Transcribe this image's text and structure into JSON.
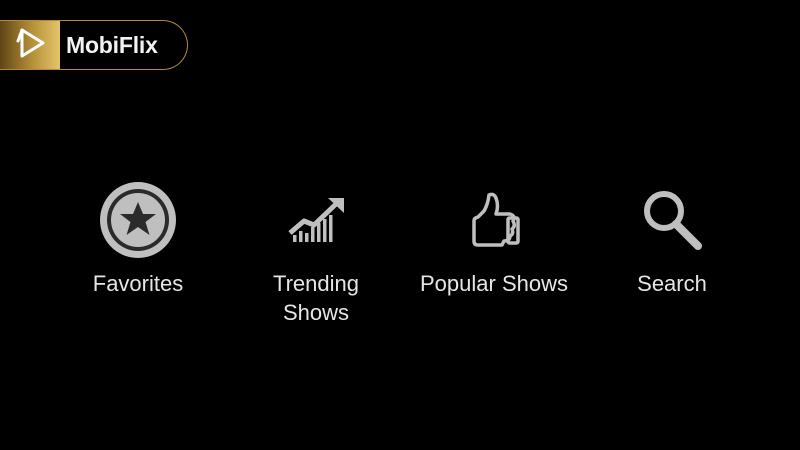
{
  "brand": {
    "name": "MobiFlix",
    "icon": "play-logo-icon",
    "accent_color": "#c9a24a"
  },
  "menu": {
    "items": [
      {
        "label": "Favorites",
        "icon": "star-badge-icon"
      },
      {
        "label": "Trending Shows",
        "icon": "trending-chart-icon"
      },
      {
        "label": "Popular Shows",
        "icon": "thumbs-up-icon"
      },
      {
        "label": "Search",
        "icon": "search-icon"
      }
    ]
  },
  "colors": {
    "background": "#000000",
    "icon": "#bfbfbf",
    "text": "#e6e6e6"
  }
}
